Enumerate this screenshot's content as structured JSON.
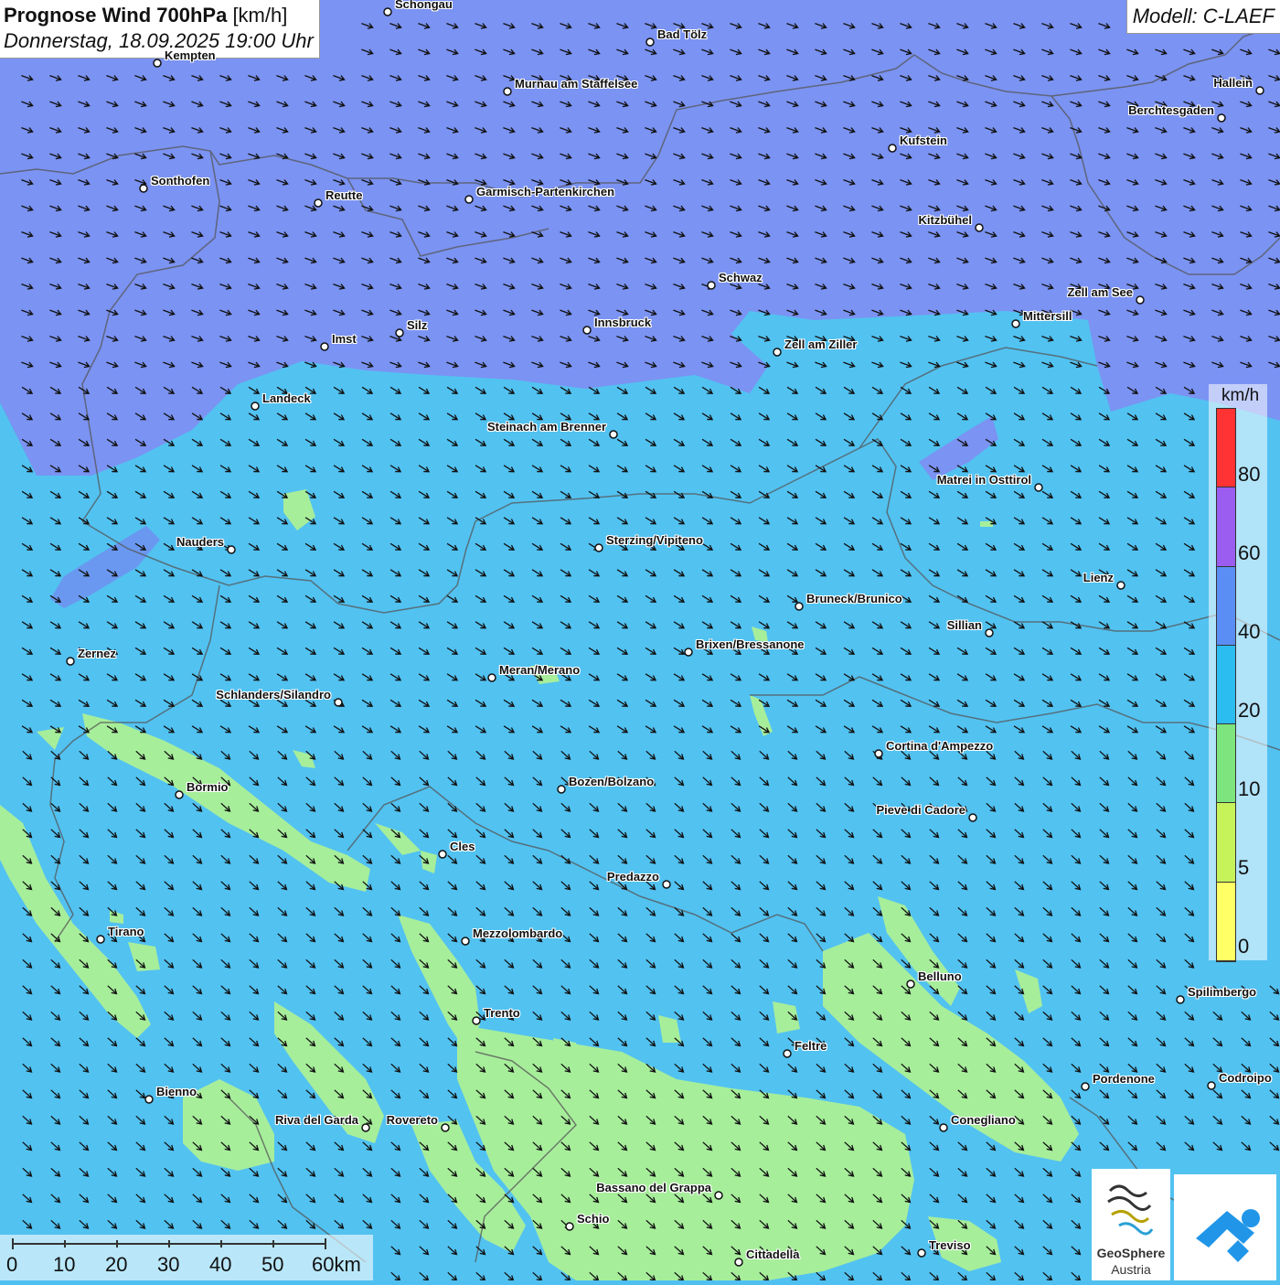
{
  "title": {
    "main": "Prognose Wind 700hPa",
    "unit": "[km/h]",
    "date": "Donnerstag, 18.09.2025 19:00 Uhr"
  },
  "model": "Modell: C-LAEF",
  "legend": {
    "unit": "km/h",
    "ticks": [
      "80",
      "60",
      "40",
      "20",
      "10",
      "5",
      "0"
    ],
    "colors": [
      "#ff3333",
      "#9b5cf0",
      "#5b8ef5",
      "#2bbcf0",
      "#7ee57e",
      "#c6f25a",
      "#ffff66"
    ]
  },
  "scale_labels": [
    "0",
    "10",
    "20",
    "30",
    "40",
    "50",
    "60km"
  ],
  "logo": {
    "line1": "GeoSphere",
    "line2": "Austria"
  },
  "colors": {
    "band_40_60": "#7b8ff3",
    "band_20_40": "#5cc3f2",
    "band_10_20": "#a6ee9a",
    "arrow": "#111111"
  },
  "cities": [
    {
      "name": "Schongau"
    },
    {
      "name": "Bad Tölz"
    },
    {
      "name": "Kempten"
    },
    {
      "name": "Murnau am Staffelsee"
    },
    {
      "name": "Hallein"
    },
    {
      "name": "Berchtesgaden"
    },
    {
      "name": "Kufstein"
    },
    {
      "name": "Sonthofen"
    },
    {
      "name": "Reutte"
    },
    {
      "name": "Garmisch-Partenkirchen"
    },
    {
      "name": "Kitzbühel"
    },
    {
      "name": "Schwaz"
    },
    {
      "name": "Zell am See"
    },
    {
      "name": "Mittersill"
    },
    {
      "name": "Innsbruck"
    },
    {
      "name": "Silz"
    },
    {
      "name": "Imst"
    },
    {
      "name": "Zell am Ziller"
    },
    {
      "name": "Landeck"
    },
    {
      "name": "Steinach am Brenner"
    },
    {
      "name": "Matrei in Osttirol"
    },
    {
      "name": "Nauders"
    },
    {
      "name": "Sterzing/Vipiteno"
    },
    {
      "name": "Lienz"
    },
    {
      "name": "Bruneck/Brunico"
    },
    {
      "name": "Sillian"
    },
    {
      "name": "Brixen/Bressanone"
    },
    {
      "name": "Zernez"
    },
    {
      "name": "Meran/Merano"
    },
    {
      "name": "Schlanders/Silandro"
    },
    {
      "name": "Cortina d'Ampezzo"
    },
    {
      "name": "Bozen/Bolzano"
    },
    {
      "name": "Bormio"
    },
    {
      "name": "Pieve di Cadore"
    },
    {
      "name": "Cles"
    },
    {
      "name": "Predazzo"
    },
    {
      "name": "Tirano"
    },
    {
      "name": "Mezzolombardo"
    },
    {
      "name": "Belluno"
    },
    {
      "name": "Spilimbergo"
    },
    {
      "name": "Trento"
    },
    {
      "name": "Feltre"
    },
    {
      "name": "Pordenone"
    },
    {
      "name": "Codroipo"
    },
    {
      "name": "Bienno"
    },
    {
      "name": "Riva del Garda"
    },
    {
      "name": "Rovereto"
    },
    {
      "name": "Conegliano"
    },
    {
      "name": "Bassano del Grappa"
    },
    {
      "name": "Schio"
    },
    {
      "name": "Treviso"
    },
    {
      "name": "Cittadella"
    }
  ]
}
